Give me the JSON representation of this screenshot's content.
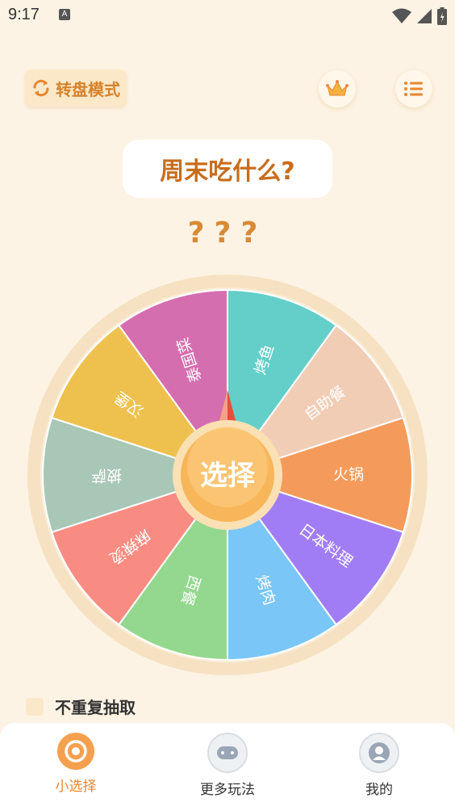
{
  "status_bar": {
    "time": "9:17",
    "notif_icon": "A"
  },
  "header": {
    "mode_label": "转盘模式",
    "crown_icon": "crown-icon",
    "menu_icon": "list-icon"
  },
  "title": "周末吃什么?",
  "result": "???",
  "wheel": {
    "center_label": "选择",
    "segments": [
      {
        "label": "烤鱼",
        "color": "#63cfc8"
      },
      {
        "label": "自助餐",
        "color": "#f2cdb6"
      },
      {
        "label": "火锅",
        "color": "#f49b5b"
      },
      {
        "label": "日本料理",
        "color": "#a17df5"
      },
      {
        "label": "烤肉",
        "color": "#79c6f7"
      },
      {
        "label": "西餐",
        "color": "#93d88e"
      },
      {
        "label": "麻辣烫",
        "color": "#f98c82"
      },
      {
        "label": "披萨",
        "color": "#a8c7b6"
      },
      {
        "label": "汉堡",
        "color": "#eec14f"
      },
      {
        "label": "泰国菜",
        "color": "#d56eaf"
      }
    ]
  },
  "no_repeat_label": "不重复抽取",
  "tabs": [
    {
      "label": "小选择",
      "active": true
    },
    {
      "label": "更多玩法",
      "active": false
    },
    {
      "label": "我的",
      "active": false
    }
  ]
}
